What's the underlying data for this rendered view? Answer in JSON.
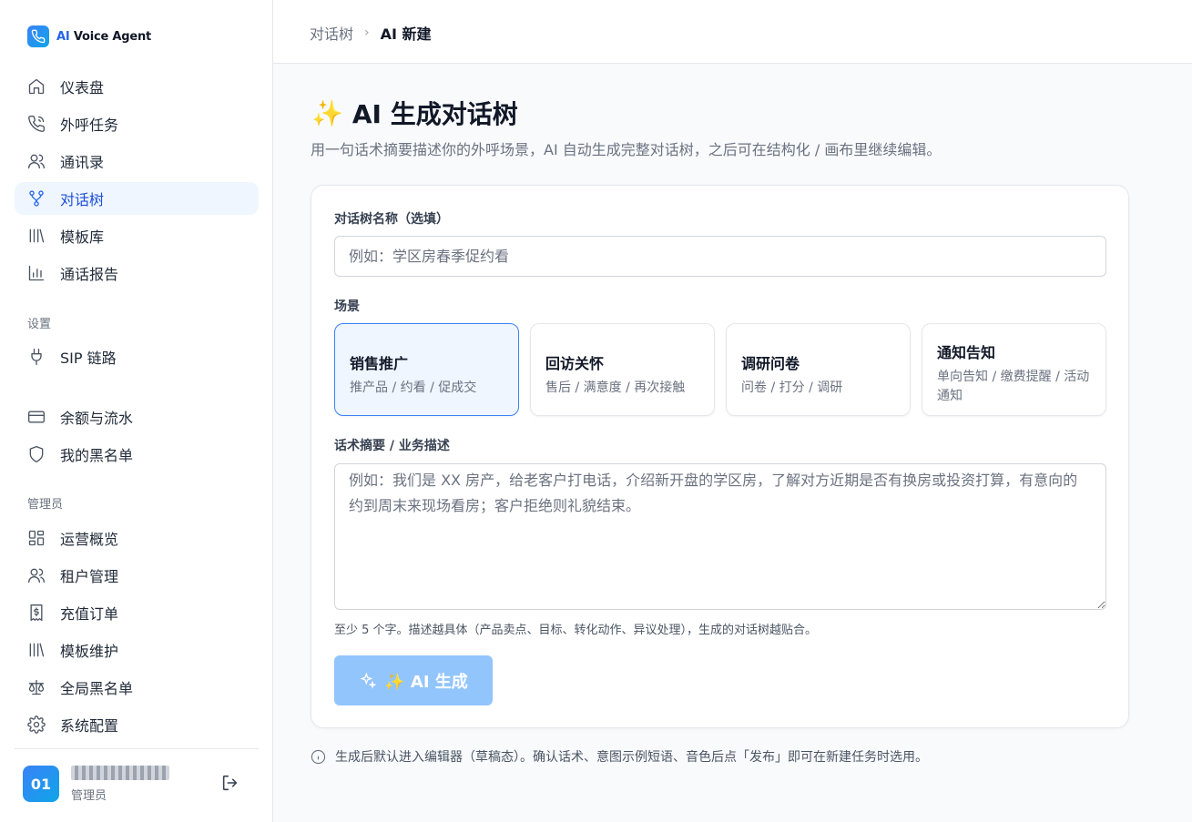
{
  "app": {
    "brand_ai": "AI",
    "brand_rest": " Voice Agent"
  },
  "sidebar": {
    "main_items": [
      {
        "label": "仪表盘",
        "icon": "home-icon"
      },
      {
        "label": "外呼任务",
        "icon": "phone-icon"
      },
      {
        "label": "通讯录",
        "icon": "users-icon"
      },
      {
        "label": "对话树",
        "icon": "tree-icon",
        "active": true
      },
      {
        "label": "模板库",
        "icon": "library-icon"
      },
      {
        "label": "通话报告",
        "icon": "chart-icon"
      }
    ],
    "settings_title": "设置",
    "settings_items": [
      {
        "label": "SIP 链路",
        "icon": "plug-icon"
      },
      {
        "label": "余额与流水",
        "icon": "card-icon"
      },
      {
        "label": "我的黑名单",
        "icon": "shield-icon"
      }
    ],
    "admin_title": "管理员",
    "admin_items": [
      {
        "label": "运营概览",
        "icon": "grid-icon"
      },
      {
        "label": "租户管理",
        "icon": "users-icon"
      },
      {
        "label": "充值订单",
        "icon": "receipt-icon"
      },
      {
        "label": "模板维护",
        "icon": "library-icon"
      },
      {
        "label": "全局黑名单",
        "icon": "scale-icon"
      },
      {
        "label": "系统配置",
        "icon": "gear-icon"
      }
    ],
    "user": {
      "avatar": "01",
      "role": "管理员"
    }
  },
  "breadcrumb": {
    "parent": "对话树",
    "current": "AI 新建"
  },
  "page": {
    "title_icon": "✨",
    "title": "AI 生成对话树",
    "subtitle": "用一句话术摘要描述你的外呼场景，AI 自动生成完整对话树，之后可在结构化 / 画布里继续编辑。"
  },
  "form": {
    "name_label": "对话树名称（选填）",
    "name_placeholder": "例如：学区房春季促约看",
    "name_value": "",
    "scene_label": "场景",
    "scenes": [
      {
        "name": "销售推广",
        "desc": "推产品 / 约看 / 促成交",
        "selected": true
      },
      {
        "name": "回访关怀",
        "desc": "售后 / 满意度 / 再次接触"
      },
      {
        "name": "调研问卷",
        "desc": "问卷 / 打分 / 调研"
      },
      {
        "name": "通知告知",
        "desc": "单向告知 / 缴费提醒 / 活动通知"
      }
    ],
    "summary_label": "话术摘要 / 业务描述",
    "summary_placeholder": "例如：我们是 XX 房产，给老客户打电话，介绍新开盘的学区房，了解对方近期是否有换房或投资打算，有意向的约到周末来现场看房；客户拒绝则礼貌结束。",
    "hint": "至少 5 个字。描述越具体（产品卖点、目标、转化动作、异议处理），生成的对话树越贴合。",
    "generate_label": "✨ AI 生成"
  },
  "footer_note": "生成后默认进入编辑器（草稿态）。确认话术、意图示例短语、音色后点「发布」即可在新建任务时选用。",
  "colors": {
    "accent": "#2563eb",
    "active_bg": "#eff6ff",
    "button_disabled": "#93c5fd"
  }
}
